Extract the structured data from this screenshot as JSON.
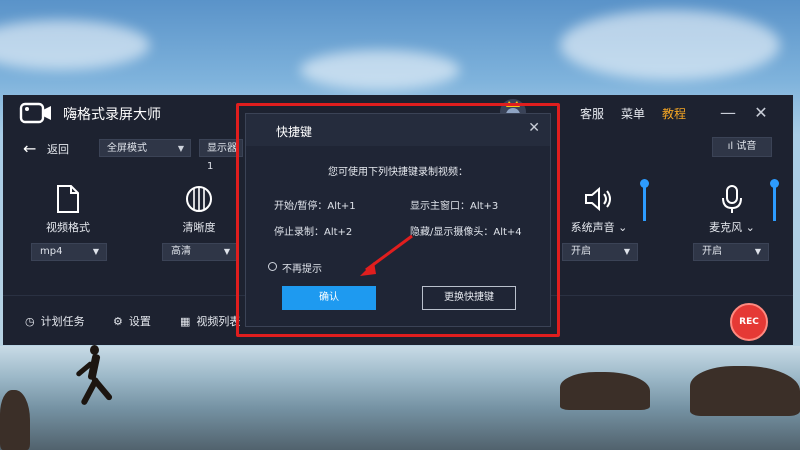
{
  "app": {
    "title": "嗨格式录屏大师",
    "service_label": "客服",
    "menu_label": "菜单",
    "tutorial_label": "教程"
  },
  "toolbar": {
    "back_label": "返回",
    "mode_select": "全屏模式",
    "display_select": "显示器1",
    "listen_label": "试音"
  },
  "tools": [
    {
      "label": "视频格式",
      "value": "mp4",
      "icon": "file-icon"
    },
    {
      "label": "清晰度",
      "value": "高清",
      "icon": "aperture-icon"
    },
    {
      "label": "系统声音",
      "value": "开启",
      "icon": "speaker-icon"
    },
    {
      "label": "麦克风",
      "value": "开启",
      "icon": "microphone-icon"
    }
  ],
  "bottom": {
    "schedule_label": "计划任务",
    "settings_label": "设置",
    "video_list_label": "视频列表",
    "rec_label": "REC"
  },
  "dialog": {
    "title": "快捷键",
    "intro": "您可使用下列快捷键录制视频：",
    "shortcuts": [
      "开始/暂停：Alt+1",
      "显示主窗口：Alt+3",
      "停止录制：Alt+2",
      "隐藏/显示摄像头：Alt+4"
    ],
    "no_prompt_label": "不再提示",
    "confirm_label": "确认",
    "change_label": "更换快捷键"
  },
  "colors": {
    "accent": "#1e9af0",
    "tutorial": "#f5a623",
    "rec": "#e53935",
    "highlight": "#e01e1e"
  }
}
